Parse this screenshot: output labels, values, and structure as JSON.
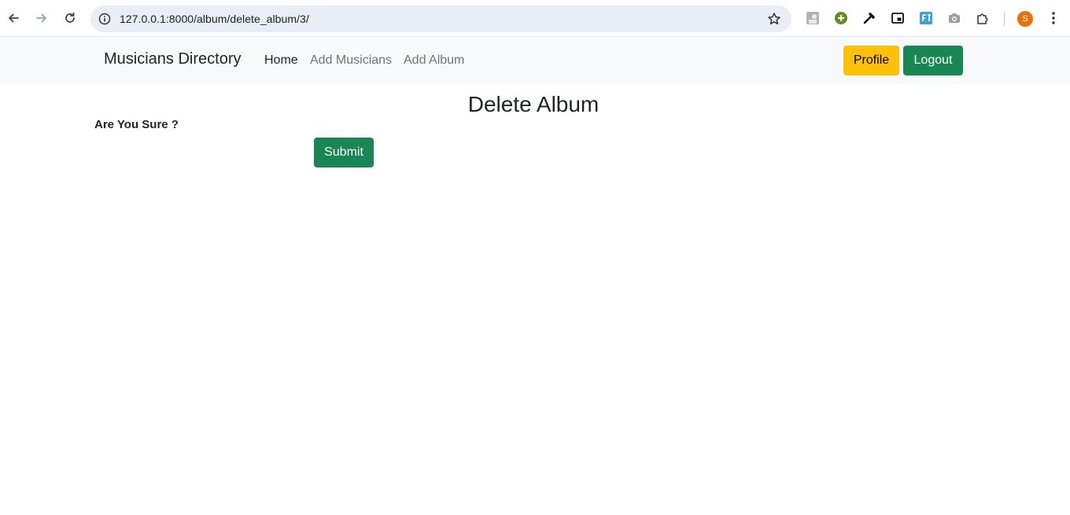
{
  "browser": {
    "url": "127.0.0.1:8000/album/delete_album/3/",
    "profile_initial": "S"
  },
  "navbar": {
    "brand": "Musicians Directory",
    "links": [
      {
        "label": "Home",
        "active": true
      },
      {
        "label": "Add Musicians",
        "active": false
      },
      {
        "label": "Add Album",
        "active": false
      }
    ],
    "profile_label": "Profile",
    "logout_label": "Logout"
  },
  "main": {
    "title": "Delete Album",
    "confirm_text": "Are You Sure ?",
    "submit_label": "Submit"
  },
  "colors": {
    "success": "#198754",
    "warning": "#ffc107",
    "navbar_bg": "#f8f9fa"
  }
}
